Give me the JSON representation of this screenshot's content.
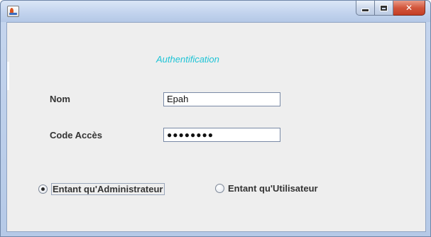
{
  "window": {
    "icon": "java-cup-icon",
    "controls": {
      "minimize": "minimize-icon",
      "maximize": "maximize-icon",
      "close": "close-icon",
      "close_glyph": "✕"
    },
    "colors": {
      "title_accent": "#1fc4d6",
      "close": "#c43e25"
    }
  },
  "form": {
    "title": "Authentification",
    "nom": {
      "label": "Nom",
      "value": "Epah"
    },
    "code": {
      "label": "Code Accès",
      "value": "●●●●●●●●"
    },
    "roles": [
      {
        "label": "Entant qu'Administrateur",
        "selected": true
      },
      {
        "label": "Entant qu'Utilisateur",
        "selected": false
      }
    ]
  }
}
